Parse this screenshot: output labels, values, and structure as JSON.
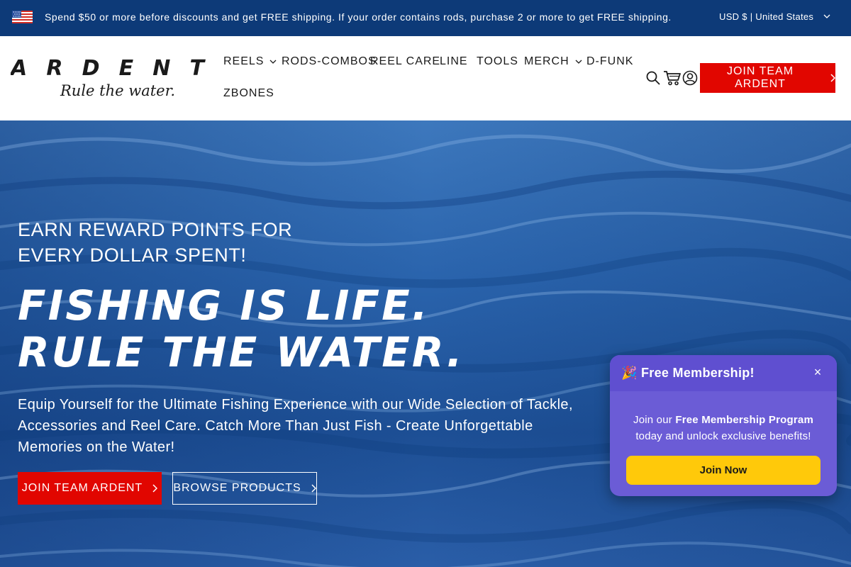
{
  "announcement": {
    "text": "Spend $50 or more before discounts and get FREE shipping. If your order contains rods, purchase 2 or more to get FREE shipping.",
    "flag_icon": "us-flag-icon",
    "currency_label": "USD $ | United States"
  },
  "header": {
    "logo": {
      "brand": "ARDENT",
      "tagline": "Rule the water."
    },
    "nav": [
      {
        "label": "REELS",
        "has_dropdown": true
      },
      {
        "label": "RODS-COMBOS",
        "has_dropdown": false
      },
      {
        "label": "REEL CARE",
        "has_dropdown": false
      },
      {
        "label": "LINE",
        "has_dropdown": false
      },
      {
        "label": "TOOLS",
        "has_dropdown": false
      },
      {
        "label": "MERCH",
        "has_dropdown": true
      },
      {
        "label": "D-FUNK",
        "has_dropdown": false
      },
      {
        "label": "ZBONES",
        "has_dropdown": false
      }
    ],
    "icons": [
      "search-icon",
      "cart-icon",
      "account-icon"
    ],
    "join_label": "JOIN TEAM ARDENT"
  },
  "hero": {
    "eyebrow": "EARN REWARD POINTS FOR EVERY DOLLAR SPENT!",
    "title_line1": "FISHING IS LIFE.",
    "title_line2": "RULE THE WATER.",
    "description": "Equip Yourself for the Ultimate Fishing Experience with our Wide Selection of Tackle, Accessories and Reel Care. Catch More Than Just Fish - Create Unforgettable Memories on the Water!",
    "join_label": "JOIN TEAM ARDENT",
    "browse_label": "BROWSE PRODUCTS"
  },
  "popup": {
    "title": "🎉 Free Membership!",
    "close_label": "×",
    "body_prefix": "Join our ",
    "body_bold": "Free Membership Program",
    "body_suffix": " today and unlock exclusive benefits!",
    "button_label": "Join Now"
  },
  "colors": {
    "announcement_bg": "#0d3a78",
    "accent_red": "#e10600",
    "popup_purple": "#6b5cd6",
    "popup_button": "#ffc90a"
  }
}
